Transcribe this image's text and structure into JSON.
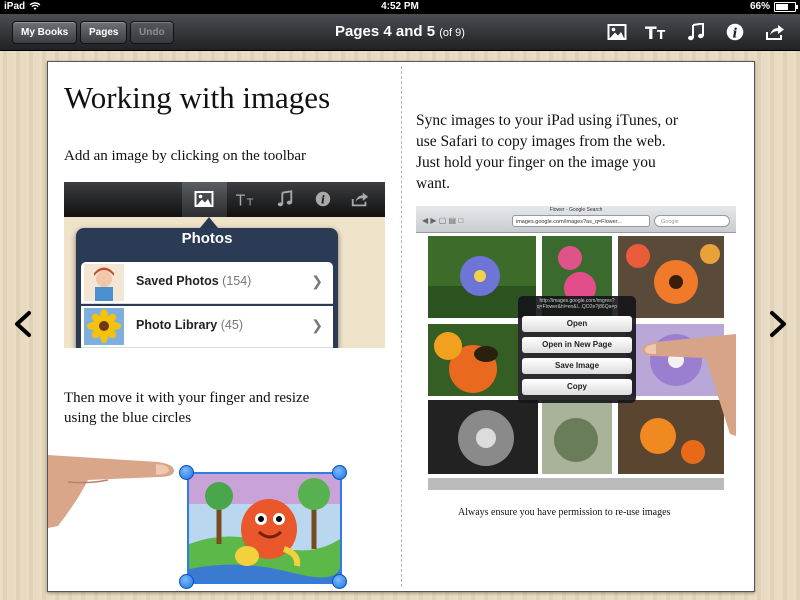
{
  "status_bar": {
    "device": "iPad",
    "time": "4:52 PM",
    "battery": "66%"
  },
  "toolbar": {
    "my_books": "My Books",
    "pages": "Pages",
    "undo": "Undo",
    "title": "Pages 4 and 5",
    "title_sub": "(of 9)"
  },
  "left_page": {
    "heading": "Working with images",
    "line1": "Add an image by clicking on the toolbar",
    "popover": {
      "title": "Photos",
      "rows": [
        {
          "label": "Saved Photos",
          "count": "(154)"
        },
        {
          "label": "Photo Library",
          "count": "(45)"
        }
      ]
    },
    "line2a": "Then move it with your finger and resize",
    "line2b": "using the blue circles"
  },
  "right_page": {
    "para1": "Sync images to your iPad using iTunes, or",
    "para2": "use Safari to copy images from the web.",
    "para3": "Just hold your finger on the image you",
    "para4": "want.",
    "browser_title": "Flower - Google Search",
    "browser_url": "images.google.com/images?as_q=Flower...",
    "browser_search": "Google",
    "menu_url": "http://images.google.com/imgres?q=Flower&hl=en&l...QO2e?j86Qa=p",
    "menu_items": [
      "Open",
      "Open in New Page",
      "Save Image",
      "Copy"
    ],
    "caption": "Always ensure you have permission to re-use images"
  },
  "colors": {
    "accent_handle": "#1e6fe0",
    "toolbar": "#2a2c2f",
    "book_background": "#e7d9bf"
  }
}
